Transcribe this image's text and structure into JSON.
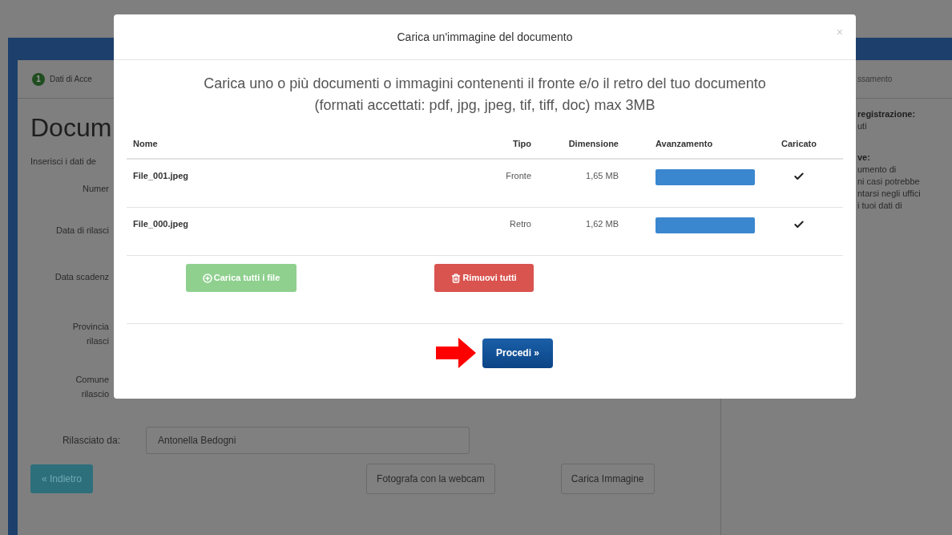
{
  "page": {
    "step_tab": {
      "number": "1",
      "label": "Dati di Acce"
    },
    "right_tab": "ssamento",
    "heading": "Docum",
    "subtitle": "Inserisci i dati de",
    "form_labels": [
      {
        "lines": [
          "Numer"
        ]
      },
      {
        "lines": [
          "Data di rilasci"
        ]
      },
      {
        "lines": [
          "Data scadenz"
        ]
      },
      {
        "lines": [
          "Provincia",
          "rilasci"
        ]
      },
      {
        "lines": [
          "Comune",
          "rilascio"
        ]
      }
    ],
    "issuer": {
      "label": "Rilasciato da:",
      "value": "Antonella Bedogni"
    },
    "buttons": [
      {
        "kind": "back",
        "label": "« Indietro"
      },
      {
        "kind": "plain",
        "label": "Fotografa con la webcam"
      },
      {
        "kind": "plain",
        "label": "Carica Immagine"
      }
    ],
    "sidebar": [
      {
        "kind": "title",
        "text": "registrazione:"
      },
      {
        "kind": "text",
        "text": "uti"
      },
      {
        "kind": "title",
        "text": "ve:"
      },
      {
        "kind": "text",
        "text": "umento di"
      },
      {
        "kind": "text",
        "text": "ni casi potrebbe"
      },
      {
        "kind": "text",
        "text": "ntarsi negli uffici"
      },
      {
        "kind": "text",
        "text": "i tuoi dati di"
      }
    ]
  },
  "modal": {
    "title": "Carica un'immagine del documento",
    "close": "×",
    "intro": [
      "Carica uno o più documenti o immagini contenenti il fronte e/o il retro del tuo documento",
      "(formati accettati: pdf, jpg, jpeg, tif, tiff, doc) max 3MB"
    ],
    "columns": [
      "Nome",
      "Tipo",
      "Dimensione",
      "Avanzamento",
      "Caricato"
    ],
    "rows": [
      {
        "name": "File_001.jpeg",
        "type": "Fronte",
        "size": "1,65 MB",
        "level": 1,
        "uploaded": true
      },
      {
        "name": "File_000.jpeg",
        "type": "Retro",
        "size": "1,62 MB",
        "level": 1,
        "uploaded": true
      }
    ],
    "actions": [
      {
        "kind": "upload",
        "label": "Carica tutti i file"
      },
      {
        "kind": "remove",
        "label": "Rimuovi tutti"
      }
    ],
    "proceed": "Procedi »"
  }
}
